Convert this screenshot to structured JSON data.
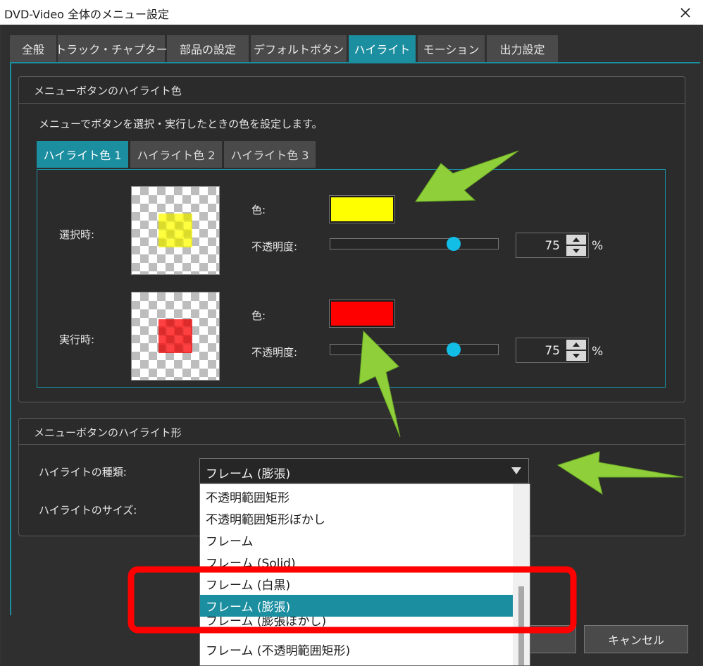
{
  "window": {
    "title": "DVD-Video 全体のメニュー設定"
  },
  "tabs": [
    {
      "label": "全般"
    },
    {
      "label": "トラック・チャプター"
    },
    {
      "label": "部品の設定"
    },
    {
      "label": "デフォルトボタン"
    },
    {
      "label": "ハイライト",
      "active": true
    },
    {
      "label": "モーション"
    },
    {
      "label": "出力設定"
    }
  ],
  "highlight_color": {
    "title": "メニューボタンのハイライト色",
    "description": "メニューでボタンを選択・実行したときの色を設定します。",
    "subtabs": [
      {
        "label": "ハイライト色 1",
        "active": true
      },
      {
        "label": "ハイライト色 2"
      },
      {
        "label": "ハイライト色 3"
      }
    ],
    "select": {
      "label": "選択時:",
      "color_label": "色:",
      "color": "#ffff00",
      "opacity_label": "不透明度:",
      "opacity_value": "75",
      "opacity_fraction": 0.75,
      "unit": "%"
    },
    "execute": {
      "label": "実行時:",
      "color_label": "色:",
      "color": "#ff0000",
      "opacity_label": "不透明度:",
      "opacity_value": "75",
      "opacity_fraction": 0.75,
      "unit": "%"
    }
  },
  "highlight_shape": {
    "title": "メニューボタンのハイライト形",
    "type_label": "ハイライトの種類:",
    "type_value": "フレーム (膨張)",
    "size_label": "ハイライトのサイズ:",
    "options": [
      "不透明範囲矩形",
      "不透明範囲矩形ぼかし",
      "フレーム",
      "フレーム (Solid)",
      "フレーム (白黒)",
      "フレーム (膨張)",
      "フレーム (膨張ぼかし)",
      "フレーム (不透明範囲矩形)"
    ],
    "selected_option": "フレーム (膨張)"
  },
  "buttons": {
    "cancel": "キャンセル"
  },
  "colors": {
    "accent": "#1b8ea0",
    "annotation_arrow": "#8fd03a",
    "annotation_box": "#ff0000"
  }
}
